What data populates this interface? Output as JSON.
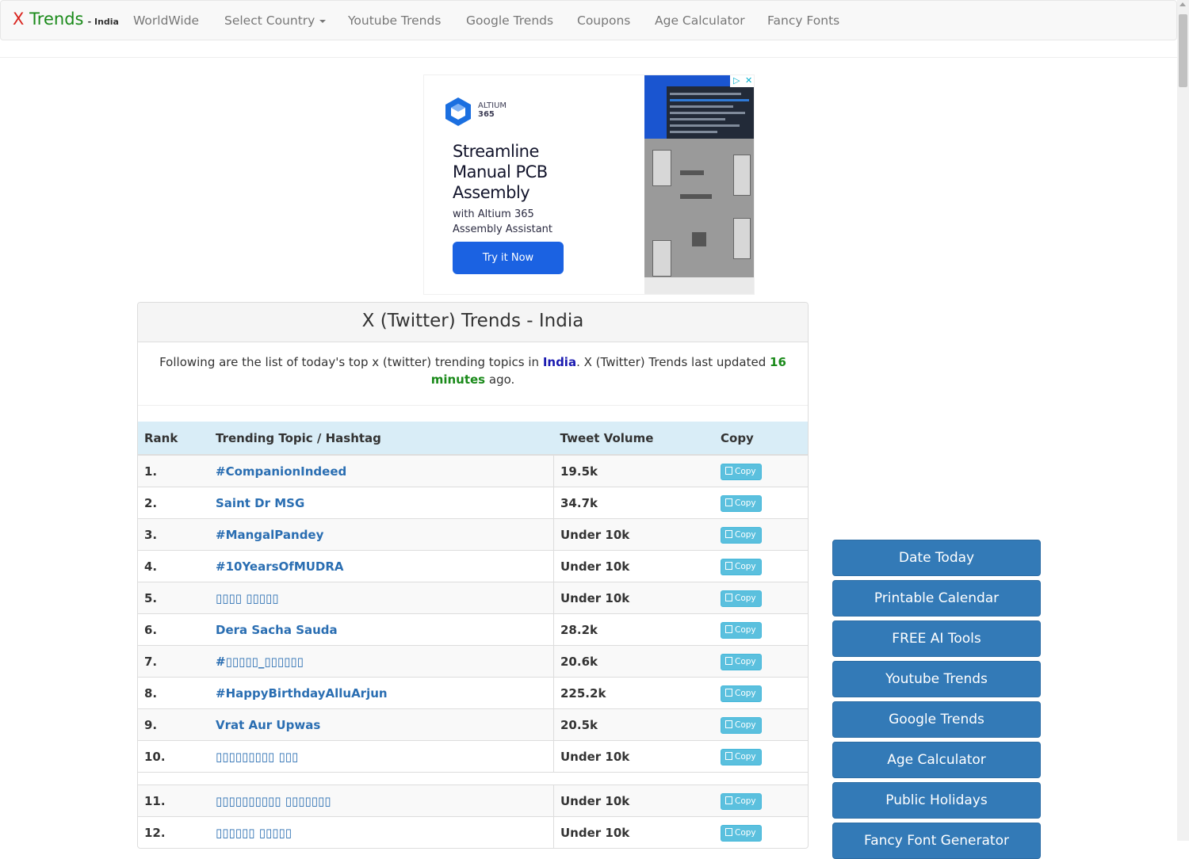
{
  "navbar": {
    "brand_x": "X",
    "brand_trends": " Trends",
    "brand_sub": "- India",
    "items": [
      "WorldWide",
      "Select Country",
      "Youtube Trends",
      "Google Trends",
      "Coupons",
      "Age Calculator",
      "Fancy Fonts"
    ]
  },
  "ad": {
    "logo_line1": "ALTIUM",
    "logo_line2": "365",
    "headline": "Streamline Manual PCB Assembly",
    "sub": "with Altium 365 Assembly Assistant",
    "button": "Try it Now"
  },
  "panel": {
    "title": "X (Twitter) Trends - India",
    "intro_pre": "Following are the list of today's top x (twitter) trending topics in ",
    "intro_country": "India",
    "intro_mid": ". X (Twitter) Trends last updated ",
    "intro_age": "16 minutes",
    "intro_post": " ago."
  },
  "table": {
    "headers": [
      "Rank",
      "Trending Topic / Hashtag",
      "Tweet Volume",
      "Copy"
    ],
    "copy_label": "Copy",
    "rows": [
      {
        "rank": "1.",
        "topic": "#CompanionIndeed",
        "volume": "19.5k"
      },
      {
        "rank": "2.",
        "topic": "Saint Dr MSG",
        "volume": "34.7k"
      },
      {
        "rank": "3.",
        "topic": "#MangalPandey",
        "volume": "Under 10k"
      },
      {
        "rank": "4.",
        "topic": "#10YearsOfMUDRA",
        "volume": "Under 10k"
      },
      {
        "rank": "5.",
        "topic": "▯▯▯▯ ▯▯▯▯▯",
        "volume": "Under 10k"
      },
      {
        "rank": "6.",
        "topic": "Dera Sacha Sauda",
        "volume": "28.2k"
      },
      {
        "rank": "7.",
        "topic": "#▯▯▯▯▯_▯▯▯▯▯▯",
        "volume": "20.6k"
      },
      {
        "rank": "8.",
        "topic": "#HappyBirthdayAlluArjun",
        "volume": "225.2k"
      },
      {
        "rank": "9.",
        "topic": "Vrat Aur Upwas",
        "volume": "20.5k"
      },
      {
        "rank": "10.",
        "topic": "▯▯▯▯▯▯▯▯▯ ▯▯▯",
        "volume": "Under 10k"
      },
      {
        "rank": "11.",
        "topic": "▯▯▯▯▯▯▯▯▯▯ ▯▯▯▯▯▯▯",
        "volume": "Under 10k"
      },
      {
        "rank": "12.",
        "topic": "▯▯▯▯▯▯ ▯▯▯▯▯",
        "volume": "Under 10k"
      }
    ]
  },
  "sidebar": {
    "buttons": [
      "Date Today",
      "Printable Calendar",
      "FREE AI Tools",
      "Youtube Trends",
      "Google Trends",
      "Age Calculator",
      "Public Holidays",
      "Fancy Font Generator"
    ]
  }
}
